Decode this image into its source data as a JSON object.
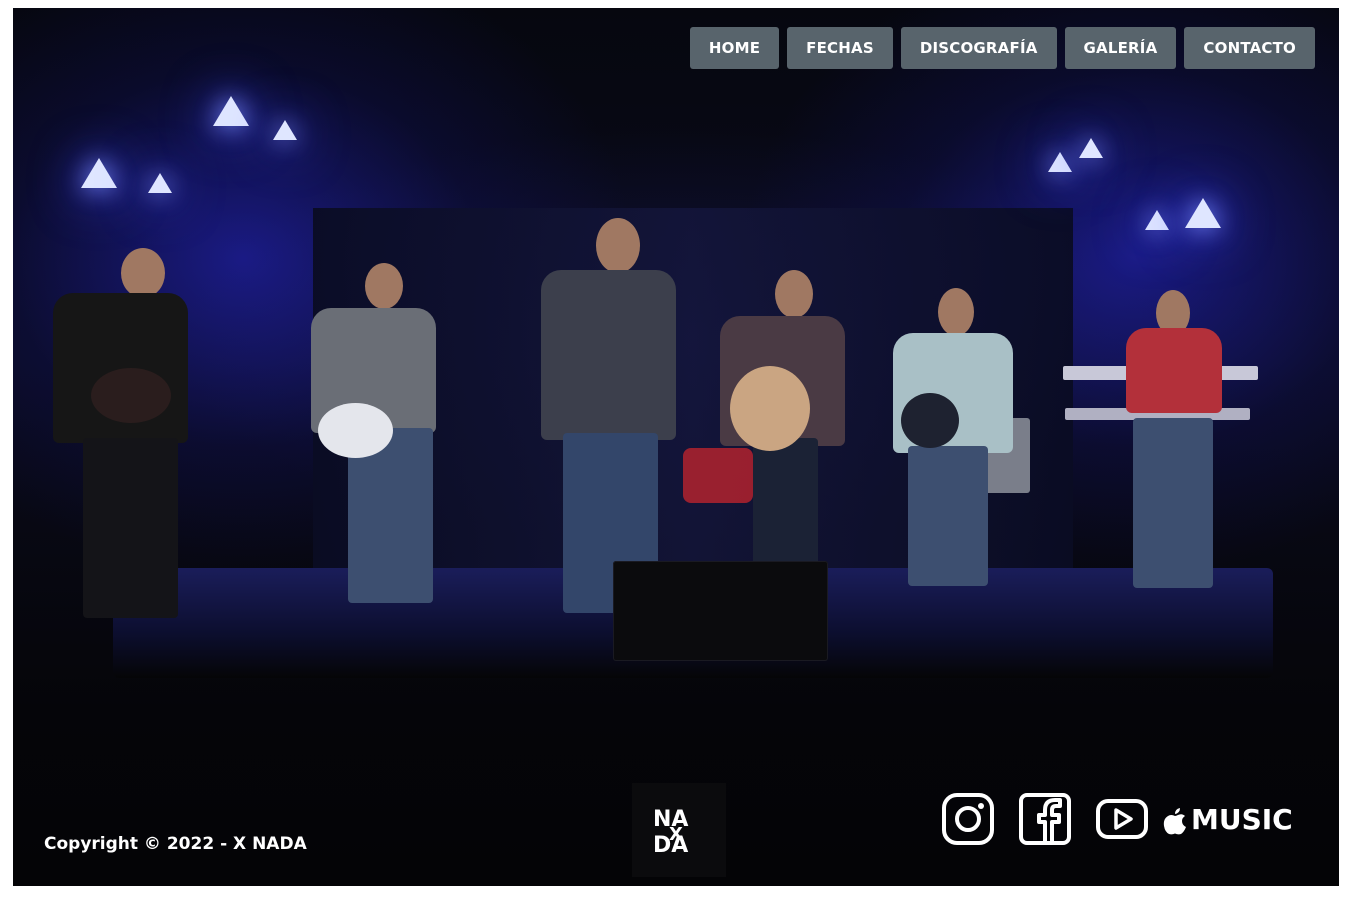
{
  "nav": {
    "items": [
      {
        "label": "HOME"
      },
      {
        "label": "FECHAS"
      },
      {
        "label": "DISCOGRAFÍA"
      },
      {
        "label": "GALERÍA"
      },
      {
        "label": "CONTACTO"
      }
    ]
  },
  "footer": {
    "copyright": "Copyright © 2022 - X NADA",
    "logo_text": "NADA",
    "social": {
      "icons": [
        "instagram-icon",
        "facebook-icon",
        "youtube-icon",
        "apple-music-icon"
      ],
      "apple_music_label": "MUSIC"
    }
  },
  "colors": {
    "nav_button_bg": "#58646c",
    "nav_text": "#ffffff",
    "stage_light": "#3a45ff"
  }
}
